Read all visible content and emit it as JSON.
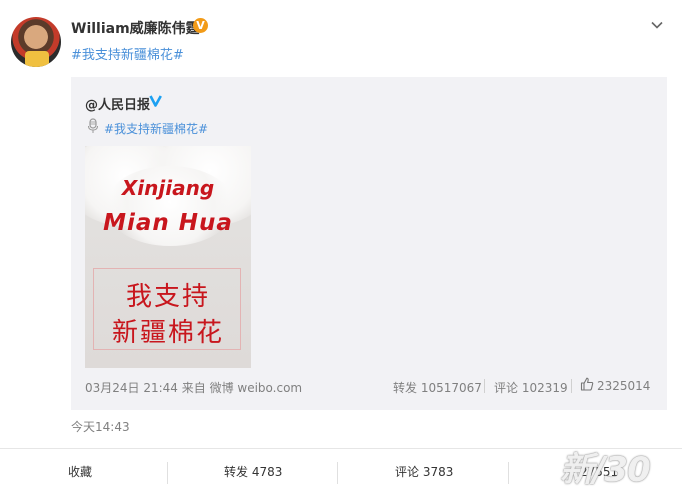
{
  "post": {
    "username": "William威廉陈伟霆",
    "verified_badge": "V",
    "hashtag": "#我支持新疆棉花#",
    "time": "今天14:43"
  },
  "repost": {
    "author": "@人民日报",
    "hashtag": "#我支持新疆棉花#",
    "image": {
      "line1": "Xinjiang",
      "line2": "Mian Hua",
      "cn_line1": "我支持",
      "cn_line2": "新疆棉花"
    },
    "meta": {
      "time_source": "03月24日 21:44 来自 微博 weibo.com",
      "reposts": "转发 10517067",
      "comments": "评论 102319",
      "likes": "2325014"
    }
  },
  "actions": {
    "favorite": "收藏",
    "repost": "转发 4783",
    "comment": "评论 3783",
    "like": "27551"
  },
  "watermark": "新/30",
  "colors": {
    "link": "#4a90d9",
    "verified_orange": "#f29b18",
    "verified_blue": "#1da1f2",
    "accent_red": "#c8161d",
    "repost_bg": "#f2f2f5"
  },
  "icons": [
    "verified-icon",
    "chevron-down-icon",
    "blue-verified-icon",
    "microphone-icon",
    "thumbs-up-icon"
  ]
}
